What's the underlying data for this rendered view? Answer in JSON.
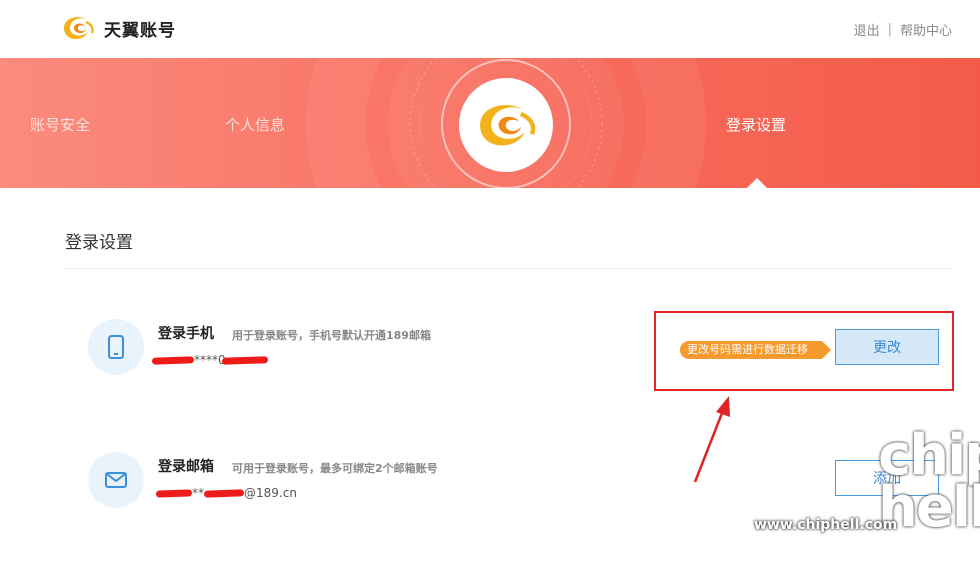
{
  "brand": {
    "name": "天翼账号",
    "icon": "tianyi-swirl-logo"
  },
  "top_links": {
    "logout": "退出",
    "separator": "|",
    "help": "帮助中心"
  },
  "banner": {
    "nav": [
      {
        "label": "账号安全",
        "active": false
      },
      {
        "label": "个人信息",
        "active": false
      },
      {
        "label": "登录设置",
        "active": true
      }
    ],
    "avatar_icon": "tianyi-swirl-logo",
    "colors": {
      "gradient_start": "#fb8b7d",
      "gradient_end": "#f35b48"
    }
  },
  "section": {
    "title": "登录设置"
  },
  "login_phone": {
    "title": "登录手机",
    "desc": "用于登录账号，手机号默认开通189邮箱",
    "value_visible": "****0",
    "icon": "phone-icon",
    "tip": "更改号码需进行数据迁移",
    "button": "更改"
  },
  "login_email": {
    "title": "登录邮箱",
    "desc": "可用于登录账号，最多可绑定2个邮箱账号",
    "value_visible": "**",
    "value_suffix": "@189.cn",
    "icon": "mail-icon",
    "button": "添加"
  },
  "watermark": {
    "url": "www.chiphell.com",
    "logo_text": "chip hell"
  },
  "annotation_color": "#e02424",
  "accent_color": "#4a9be0"
}
